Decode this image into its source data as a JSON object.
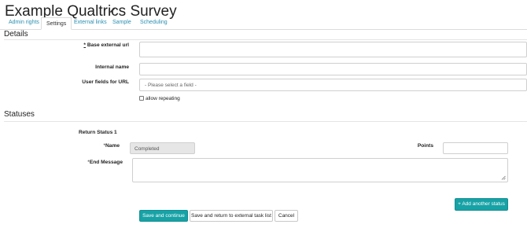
{
  "header": {
    "title": "Example Qualtrics Survey",
    "edit_icon": "pencil-icon"
  },
  "tabs": [
    {
      "label": "Admin rights",
      "active": false
    },
    {
      "label": "Settings",
      "active": true
    },
    {
      "label": "External links",
      "active": false
    },
    {
      "label": "Sample",
      "active": false
    },
    {
      "label": "Scheduling",
      "active": false
    }
  ],
  "details": {
    "heading": "Details",
    "base_url": {
      "label": "Base external url",
      "required_marker": "*",
      "value": ""
    },
    "internal_name": {
      "label": "Internal name",
      "value": ""
    },
    "user_fields": {
      "label": "User fields for URL",
      "placeholder": "- Please select a field -"
    },
    "allow_repeating": {
      "label": "allow repeating",
      "checked": false
    }
  },
  "statuses": {
    "heading": "Statuses",
    "status_title": "Return Status 1",
    "name": {
      "label": "Name",
      "required_marker": "*",
      "value": "Completed"
    },
    "points": {
      "label": "Points",
      "value": ""
    },
    "end_message": {
      "label": "End Message",
      "required_marker": "*",
      "value": ""
    },
    "add_button": "+ Add another status"
  },
  "actions": {
    "save_continue": "Save and continue",
    "save_return": "Save and return to external task list",
    "cancel": "Cancel"
  },
  "colors": {
    "accent": "#17a2a6",
    "link": "#2a8fb0"
  }
}
